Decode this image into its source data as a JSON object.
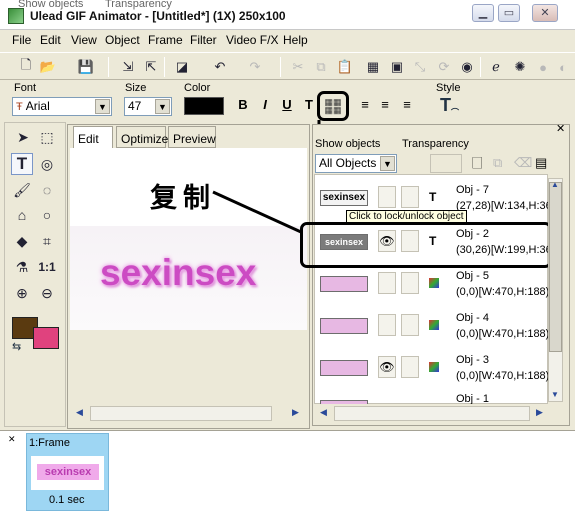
{
  "window": {
    "title": "Ulead GIF Animator - [Untitled*] (1X) 250x100",
    "ghost_labels": [
      "Show objects",
      "Transparency"
    ]
  },
  "menu": [
    "File",
    "Edit",
    "View",
    "Object",
    "Frame",
    "Filter",
    "Video F/X",
    "Help"
  ],
  "toolbar": {
    "icons": [
      "new-icon",
      "open-icon",
      "save-icon",
      "import-icon",
      "export-icon",
      "optimize-wizard-icon",
      "undo-icon",
      "redo-icon",
      "cut-icon",
      "copy-icon",
      "paste-icon",
      "crop-icon",
      "duplicate-icon",
      "resize-icon",
      "rotate-icon",
      "preview-browser-icon",
      "ie-icon",
      "wizard-icon"
    ]
  },
  "props": {
    "font_label": "Font",
    "font_value": "Arial",
    "size_label": "Size",
    "size_value": "47",
    "color_label": "Color",
    "color_swatch": "#000000",
    "style_label": "Style",
    "bold": "B",
    "italic": "I",
    "underline": "U",
    "text_tool": "T"
  },
  "tabs": [
    "Edit",
    "Optimize",
    "Preview"
  ],
  "canvas": {
    "text": "sexinsex",
    "annotation": "复制"
  },
  "left_tools": {
    "zoom_label": "1:1",
    "fg_color": "#5a3a10",
    "bg_color": "#e0427e"
  },
  "objects": {
    "show_label": "Show objects",
    "transparency_label": "Transparency",
    "filter_value": "All Objects",
    "tooltip": "Click to lock/unlock object",
    "rows": [
      {
        "name": "Obj - 7",
        "detail": "(27,28)[W:134,H:36",
        "thumb_text": "sexinsex"
      },
      {
        "name": "Obj - 2",
        "detail": "(30,26)[W:199,H:36",
        "thumb_text": "sexinsex"
      },
      {
        "name": "Obj - 5",
        "detail": "(0,0)[W:470,H:188)",
        "thumb_text": ""
      },
      {
        "name": "Obj - 4",
        "detail": "(0,0)[W:470,H:188)",
        "thumb_text": ""
      },
      {
        "name": "Obj - 3",
        "detail": "(0,0)[W:470,H:188)",
        "thumb_text": ""
      },
      {
        "name": "Obj - 1",
        "detail": "",
        "thumb_text": ""
      }
    ]
  },
  "frames": [
    {
      "label": "1:Frame",
      "delay": "0.1 sec",
      "thumb_text": "sexinsex"
    }
  ],
  "colors": {
    "annotation_box": "#000000",
    "pink_text": "#cc4bc3",
    "frame_selected": "#9ed6f3"
  }
}
